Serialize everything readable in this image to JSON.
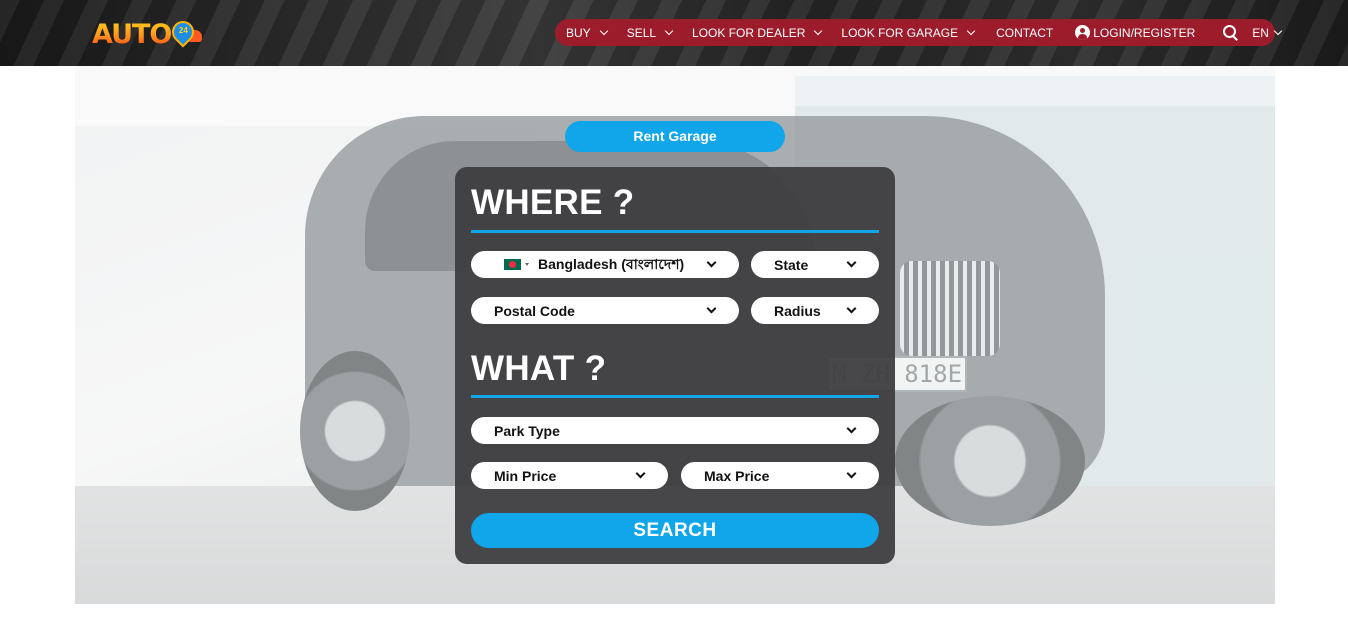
{
  "header": {
    "logo": {
      "text": "AUTO",
      "pin_number": "24"
    },
    "nav": {
      "buy": "BUY",
      "sell": "SELL",
      "look_for_dealer": "LOOK FOR DEALER",
      "look_for_garage": "LOOK FOR GARAGE",
      "contact": "CONTACT",
      "login_register": "LOGIN/REGISTER",
      "language": "EN"
    },
    "icons": [
      "chevron-down-icon",
      "user-icon",
      "search-icon"
    ]
  },
  "hero": {
    "plate_text": "M ZH 818E",
    "rent_button": "Rent Garage"
  },
  "search_form": {
    "where_heading": "WHERE ?",
    "country": {
      "value": "Bangladesh (বাংলাদেশ)",
      "flag": "bd-flag-icon"
    },
    "state": "State",
    "postal_code": "Postal Code",
    "radius": "Radius",
    "what_heading": "WHAT ?",
    "park_type": "Park Type",
    "min_price": "Min Price",
    "max_price": "Max Price",
    "search_button": "SEARCH"
  },
  "colors": {
    "nav_bg": "#9c1c2b",
    "accent": "#11a6ea",
    "panel_bg": "#3e3e40"
  }
}
